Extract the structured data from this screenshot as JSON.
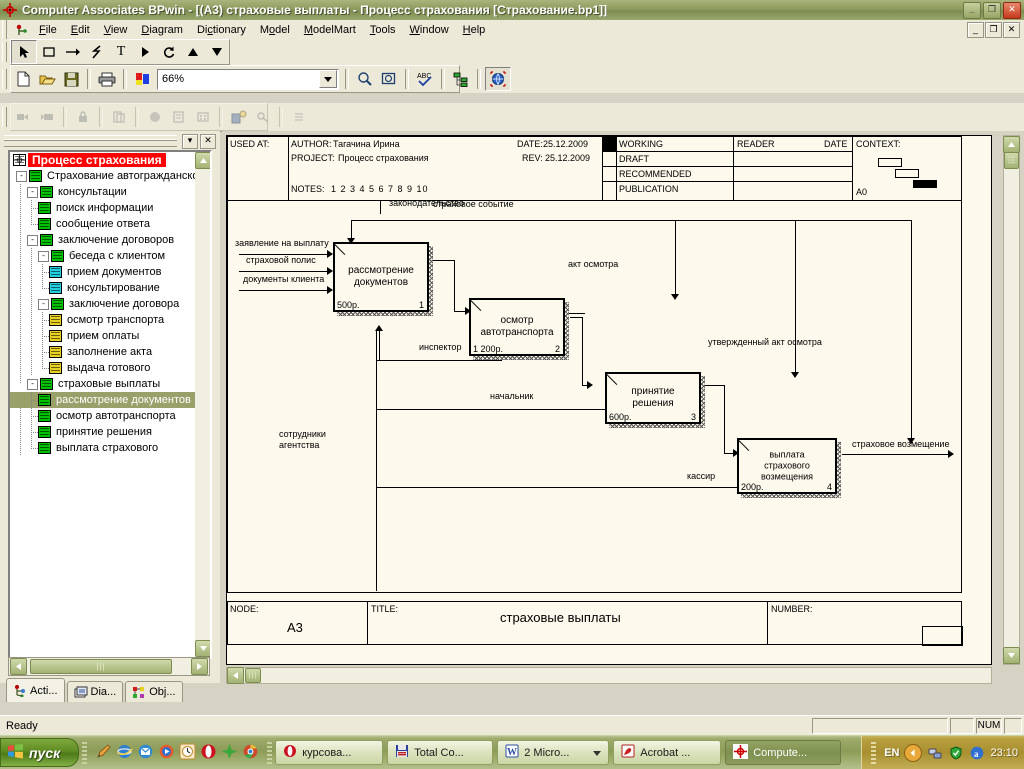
{
  "window": {
    "title": "Computer Associates BPwin - [(A3) страховые выплаты  - Процесс страхования  [Страхование.bp1]]",
    "app_icon": "bpwin-target-icon",
    "minimize": "_",
    "maximize": "❐",
    "close": "✕",
    "mdi_minimize": "_",
    "mdi_restore": "❐",
    "mdi_close": "✕"
  },
  "menu": {
    "items": [
      {
        "label": "File"
      },
      {
        "label": "Edit"
      },
      {
        "label": "View"
      },
      {
        "label": "Diagram"
      },
      {
        "label": "Dictionary"
      },
      {
        "label": "Model"
      },
      {
        "label": "ModelMart"
      },
      {
        "label": "Tools"
      },
      {
        "label": "Window"
      },
      {
        "label": "Help"
      }
    ]
  },
  "toolbars": {
    "tools": [
      {
        "name": "pointer-tool",
        "glyph": "➤"
      },
      {
        "name": "activity-box-tool",
        "glyph": "▭"
      },
      {
        "name": "arrow-tool",
        "glyph": "→"
      },
      {
        "name": "squiggle-tool",
        "glyph": "ϟ"
      },
      {
        "name": "text-tool",
        "glyph": "T"
      },
      {
        "name": "goto-child-tool",
        "glyph": "▶"
      },
      {
        "name": "rotate-tool",
        "glyph": "↺"
      },
      {
        "name": "up-tool",
        "glyph": "▲"
      },
      {
        "name": "down-tool",
        "glyph": "▼"
      }
    ],
    "standard": [
      {
        "name": "new-document-button",
        "glyph": "🗋"
      },
      {
        "name": "open-folder-button",
        "glyph": "📂"
      },
      {
        "name": "save-button",
        "glyph": "💾"
      },
      {
        "name": "print-button",
        "glyph": "🖨"
      },
      {
        "name": "color-palette-button",
        "glyph": "◧"
      }
    ],
    "zoom": {
      "value": "66%",
      "dropdown_icon": "chevron-down-icon"
    },
    "standard_right": [
      {
        "name": "zoom-in-button",
        "glyph": "🔍"
      },
      {
        "name": "fit-to-window-button",
        "glyph": "⛶"
      },
      {
        "name": "spell-check-button",
        "glyph": "ABC"
      },
      {
        "name": "model-explorer-button",
        "glyph": "▤"
      },
      {
        "name": "report-globe-button",
        "glyph": "🌐"
      }
    ],
    "modelmart": [
      {
        "name": "mm-checkout-button"
      },
      {
        "name": "mm-checkin-button"
      },
      {
        "name": "mm-lock-button"
      },
      {
        "name": "mm-refresh-button"
      },
      {
        "name": "mm-merge-button"
      },
      {
        "name": "mm-compare-button"
      },
      {
        "name": "mm-grid-button"
      },
      {
        "name": "mm-user-button"
      },
      {
        "name": "mm-security-button"
      },
      {
        "name": "mm-sync-button"
      }
    ]
  },
  "model_explorer": {
    "close_label": "✕",
    "dropdown_label": "▾",
    "root": "Процесс страхования",
    "nodes": [
      {
        "label": "Страхование автогражданской",
        "level": 0,
        "icon": "green",
        "expander": "-"
      },
      {
        "label": "консультации",
        "level": 1,
        "icon": "green",
        "expander": "-"
      },
      {
        "label": "поиск информации",
        "level": 2,
        "icon": "green",
        "expander": ""
      },
      {
        "label": "сообщение ответа",
        "level": 2,
        "icon": "green",
        "expander": ""
      },
      {
        "label": "заключение договоров",
        "level": 1,
        "icon": "green",
        "expander": "-"
      },
      {
        "label": "беседа с клиентом",
        "level": 2,
        "icon": "green",
        "expander": "-"
      },
      {
        "label": "прием документов",
        "level": 3,
        "icon": "cyan",
        "expander": ""
      },
      {
        "label": "консультирование",
        "level": 3,
        "icon": "cyan",
        "expander": ""
      },
      {
        "label": "заключение договора",
        "level": 2,
        "icon": "green",
        "expander": "-"
      },
      {
        "label": "осмотр транспорта",
        "level": 3,
        "icon": "yellow",
        "expander": ""
      },
      {
        "label": "прием оплаты",
        "level": 3,
        "icon": "yellow",
        "expander": ""
      },
      {
        "label": "заполнение  акта",
        "level": 3,
        "icon": "yellow",
        "expander": ""
      },
      {
        "label": "выдача  готового",
        "level": 3,
        "icon": "yellow",
        "expander": ""
      },
      {
        "label": "страховые выплаты",
        "level": 1,
        "icon": "green",
        "expander": "-"
      },
      {
        "label": "рассмотрение  документов",
        "level": 2,
        "icon": "green",
        "expander": "",
        "selected": true
      },
      {
        "label": "осмотр  автотранспорта",
        "level": 2,
        "icon": "green",
        "expander": ""
      },
      {
        "label": "принятие решения",
        "level": 2,
        "icon": "green",
        "expander": ""
      },
      {
        "label": "выплата  страхового",
        "level": 2,
        "icon": "green",
        "expander": ""
      }
    ],
    "tabs": [
      {
        "label": "Acti...",
        "icon": "activities-icon",
        "active": true
      },
      {
        "label": "Dia...",
        "icon": "diagrams-icon",
        "active": false
      },
      {
        "label": "Obj...",
        "icon": "objects-icon",
        "active": false
      }
    ]
  },
  "diagram": {
    "header": {
      "used_at_label": "USED AT:",
      "author_label": "AUTHOR:",
      "author_value": "Тагачина Ирина",
      "date_label": "DATE:",
      "date_value": "25.12.2009",
      "project_label": "PROJECT:",
      "project_value": "Процесс страхования",
      "rev_label": "REV:",
      "rev_value": "25.12.2009",
      "notes_label": "NOTES:",
      "notes_value": "1  2  3  4  5  6  7  8  9  10",
      "status_rows": [
        "WORKING",
        "DRAFT",
        "RECOMMENDED",
        "PUBLICATION"
      ],
      "reader_label": "READER",
      "reader_date_label": "DATE",
      "context_label": "CONTEXT:",
      "context_node": "A0"
    },
    "activities": [
      {
        "name": "рассмотрение\nдокументов",
        "cost": "500р.",
        "number": "1"
      },
      {
        "name": "осмотр\nавтотранспорта",
        "cost": "1 200р.",
        "number": "2"
      },
      {
        "name": "принятие решения",
        "cost": "600р.",
        "number": "3"
      },
      {
        "name": "выплата\nстрахового\nвозмещения",
        "cost": "200р.",
        "number": "4"
      }
    ],
    "arrow_labels": [
      {
        "text": "законодательство",
        "kind": "control"
      },
      {
        "text": "заявление на выплату",
        "kind": "input"
      },
      {
        "text": "страховой полис",
        "kind": "input"
      },
      {
        "text": "документы клиента",
        "kind": "input"
      },
      {
        "text": "страховое событие",
        "kind": "output"
      },
      {
        "text": "акт осмотра",
        "kind": "output"
      },
      {
        "text": "утвержденный акт осмотра",
        "kind": "output"
      },
      {
        "text": "страховое возмещение",
        "kind": "output"
      },
      {
        "text": "инспектор",
        "kind": "mechanism"
      },
      {
        "text": "начальник",
        "kind": "mechanism"
      },
      {
        "text": "кассир",
        "kind": "mechanism"
      },
      {
        "text": "сотрудники\nагентства",
        "kind": "mechanism-tunnel"
      }
    ],
    "footer": {
      "node_label": "NODE:",
      "node_value": "A3",
      "title_label": "TITLE:",
      "title_value": "страховые выплаты",
      "number_label": "NUMBER:",
      "number_value": ""
    }
  },
  "statusbar": {
    "message": "Ready",
    "num_indicator": "NUM"
  },
  "taskbar": {
    "start_label": "пуск",
    "quicklaunch": [
      {
        "name": "ql-pencil-icon"
      },
      {
        "name": "ql-internet-explorer-icon"
      },
      {
        "name": "ql-outlook-icon"
      },
      {
        "name": "ql-media-player-icon"
      },
      {
        "name": "ql-clock-icon"
      },
      {
        "name": "ql-opera-icon"
      },
      {
        "name": "ql-puzzle-icon"
      },
      {
        "name": "ql-chrome-icon"
      }
    ],
    "items": [
      {
        "label": "курсова...",
        "icon": "opera-icon",
        "active": false,
        "dropdown": false
      },
      {
        "label": "Total Co...",
        "icon": "total-commander-icon",
        "active": false,
        "dropdown": false
      },
      {
        "label": "2 Micro...",
        "icon": "word-icon",
        "active": false,
        "dropdown": true
      },
      {
        "label": "Acrobat ...",
        "icon": "acrobat-icon",
        "active": false,
        "dropdown": false
      },
      {
        "label": "Compute...",
        "icon": "bpwin-icon",
        "active": true,
        "dropdown": false
      }
    ],
    "language": "EN",
    "tray": [
      {
        "name": "tray-show-hidden-icon"
      },
      {
        "name": "tray-network-icon"
      },
      {
        "name": "tray-shield-icon"
      },
      {
        "name": "tray-agnitum-icon"
      }
    ],
    "clock": "23:10"
  },
  "colors": {
    "titlebar": "#8d9b5e",
    "face": "#ece9d8",
    "canvas": "#fdf9ec",
    "selection": "#99a06a",
    "root_highlight": "#ff0000",
    "tree_green": "#00c000",
    "tree_cyan": "#22cfe0",
    "tree_yellow": "#e8d020"
  }
}
